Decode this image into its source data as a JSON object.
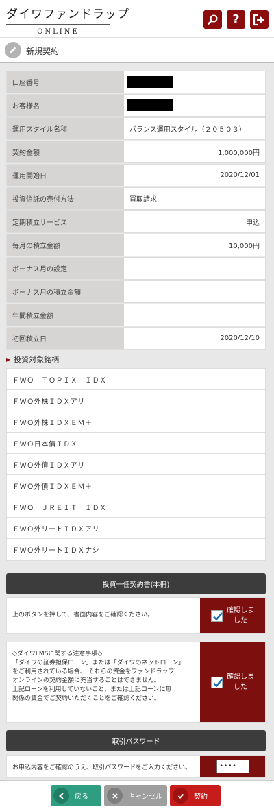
{
  "header": {
    "brand_main": "ダイワファンドラップ",
    "brand_sub": "ONLINE",
    "icons": [
      "search-icon",
      "help-icon",
      "logout-icon"
    ],
    "help_glyph": "?"
  },
  "page": {
    "title": "新規契約",
    "title_icon": "pencil-icon"
  },
  "form": {
    "rows": [
      {
        "label": "口座番号",
        "value": "",
        "redacted": true
      },
      {
        "label": "お客様名",
        "value": "",
        "redacted": true
      },
      {
        "label": "運用スタイル名称",
        "value": "バランス運用スタイル（２０５０３）"
      },
      {
        "label": "契約金額",
        "value": "1,000,000円"
      },
      {
        "label": "運用開始日",
        "value": "2020/12/01"
      },
      {
        "label": "投資信託の売付方法",
        "value": "買取請求"
      },
      {
        "label": "定期積立サービス",
        "value": "申込"
      },
      {
        "label": "毎月の積立金額",
        "value": "10,000円"
      },
      {
        "label": "ボーナス月の設定",
        "value": ""
      },
      {
        "label": "ボーナス月の積立金額",
        "value": ""
      },
      {
        "label": "年間積立金額",
        "value": ""
      },
      {
        "label": "初回積立日",
        "value": "2020/12/10"
      }
    ]
  },
  "funds": {
    "title": "投資対象銘柄",
    "items": [
      "ＦＷＯ　ＴＯＰＩＸ　ＩＤＸ",
      "ＦＷＯ外株ＩＤＸアリ",
      "ＦＷＯ外株ＩＤＸＥＭ＋",
      "ＦＷＯ日本債ＩＤＸ",
      "ＦＷＯ外債ＩＤＸアリ",
      "ＦＷＯ外債ＩＤＸＥＭ＋",
      "ＦＷＯ　ＪＲＥＩＴ　ＩＤＸ",
      "ＦＷＯ外リートＩＤＸアリ",
      "ＦＷＯ外リートＩＤＸナシ"
    ]
  },
  "contract_doc": {
    "button_label": "投資一任契約書(本冊)",
    "instruction": "上のボタンを押して、書面内容をご確認ください。",
    "confirm_line1": "確認しま",
    "confirm_line2": "した"
  },
  "lms_notice": {
    "lines": [
      "◇ダイワLMSに関する注意事項◇",
      "「ダイワの証券担保ローン」または「ダイワのネットローン」",
      "をご利用されている場合、 それらの資金をファンドラップ",
      "オンラインの契約金額に充当することはできません。",
      "上記ローンを利用していないこと、または上記ローンに無",
      "関係の資金でご契約いただくことをご確認ください。"
    ],
    "confirm_line1": "確認しま",
    "confirm_line2": "した"
  },
  "password": {
    "section_label": "取引パスワード",
    "instruction": "お申込内容をご確認のうえ、取引パスワードをご入力ください。",
    "value": "••••"
  },
  "footer": {
    "back": "戻る",
    "cancel": "キャンセル",
    "submit": "契約"
  },
  "colors": {
    "accent": "#8b0d0d",
    "confirm_bg": "#7d0f0f",
    "back_btn": "#2f9d7f",
    "cancel_btn": "#9e9e9e",
    "submit_btn": "#c61c1c",
    "label_bg": "#d7d4d4",
    "dark_button": "#3c3c3c"
  }
}
